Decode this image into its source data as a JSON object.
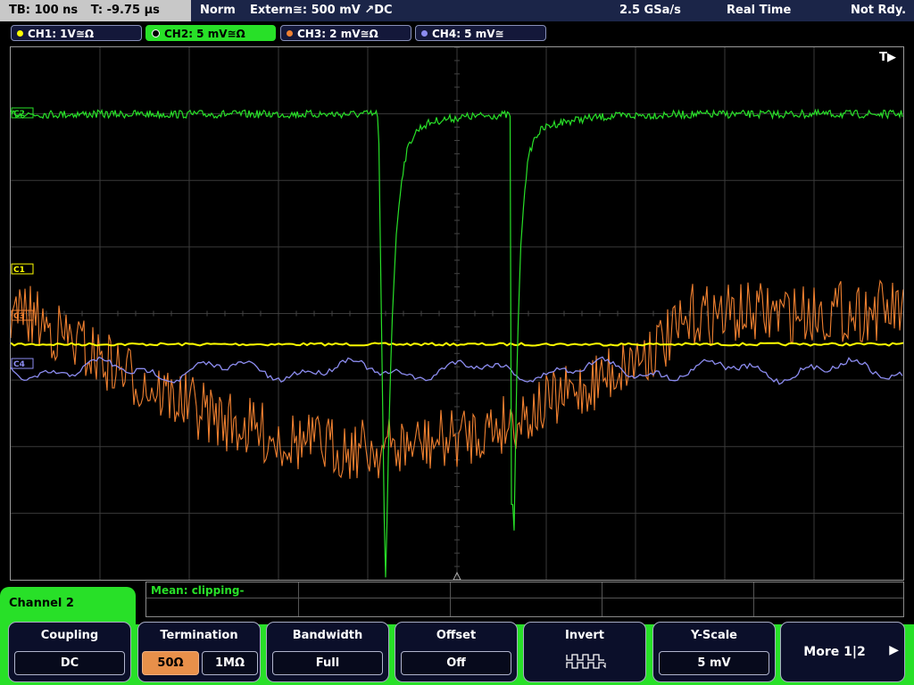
{
  "top": {
    "timebase": "TB: 100 ns",
    "trigger_time": "T: -9.75 µs",
    "mode": "Norm",
    "trigger": "Extern≅: 500 mV ↗DC",
    "sample_rate": "2.5 GSa/s",
    "acq_mode": "Real Time",
    "status": "Not Rdy."
  },
  "channels": [
    {
      "label": "CH1: 1V≅Ω",
      "color": "#ffff00",
      "active": false
    },
    {
      "label": "CH2: 5 mV≅Ω",
      "color": "#28e028",
      "active": true
    },
    {
      "label": "CH3: 2 mV≅Ω",
      "color": "#f08030",
      "active": false
    },
    {
      "label": "CH4: 5 mV≅",
      "color": "#8c8cf0",
      "active": false
    }
  ],
  "grid": {
    "trigger_marker": "T▶",
    "markers": {
      "ch1": "C1",
      "ch2": "C2",
      "ch3": "C3",
      "ch4": "C4"
    }
  },
  "measurement": {
    "mean_text": "Mean: clipping-"
  },
  "menu": {
    "channel_title": "Channel 2",
    "coupling": {
      "title": "Coupling",
      "value": "DC"
    },
    "termination": {
      "title": "Termination",
      "opt1": "50Ω",
      "opt2": "1MΩ",
      "selected": "50Ω"
    },
    "bandwidth": {
      "title": "Bandwidth",
      "value": "Full"
    },
    "offset": {
      "title": "Offset",
      "value": "Off"
    },
    "invert": {
      "title": "Invert",
      "icon": "invert-waveform-icon"
    },
    "yscale": {
      "title": "Y-Scale",
      "value": "5 mV"
    },
    "more": {
      "label": "More 1|2",
      "icon": "right-arrow-icon"
    }
  },
  "colors": {
    "ch1": "#ffff00",
    "ch2": "#28e028",
    "ch3": "#f08030",
    "ch4": "#8c8cf0",
    "accent": "#28e028",
    "panel": "#1b2548"
  }
}
